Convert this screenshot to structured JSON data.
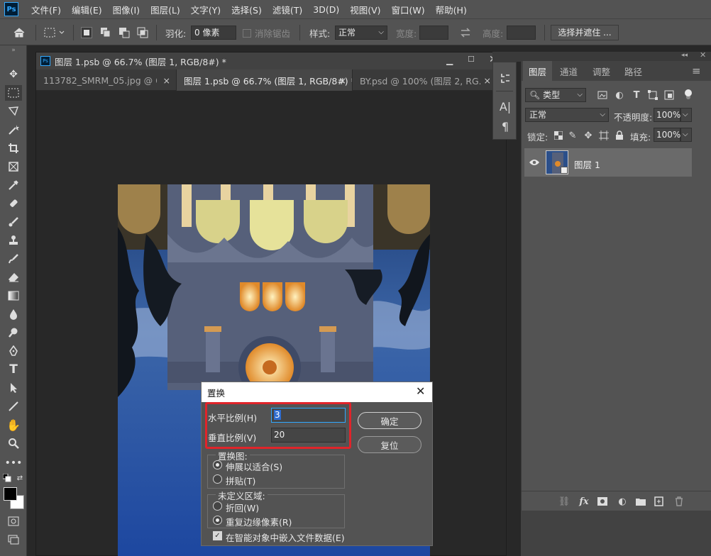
{
  "menu": {
    "logo": "Ps",
    "items": [
      "文件(F)",
      "编辑(E)",
      "图像(I)",
      "图层(L)",
      "文字(Y)",
      "选择(S)",
      "滤镜(T)",
      "3D(D)",
      "视图(V)",
      "窗口(W)",
      "帮助(H)"
    ]
  },
  "options": {
    "feather_label": "羽化:",
    "feather_value": "0 像素",
    "antialias_label": "消除锯齿",
    "style_label": "样式:",
    "style_value": "正常",
    "width_label": "宽度:",
    "height_label": "高度:",
    "select_mask_button": "选择并遮住 ..."
  },
  "document": {
    "title": "图层 1.psb @ 66.7% (图层 1, RGB/8#) *",
    "tabs": [
      {
        "label": "113782_SMRM_05.jpg @ 6...",
        "close": "×"
      },
      {
        "label": "图层 1.psb @ 66.7% (图层 1, RGB/8#) *",
        "close": "×"
      },
      {
        "label": "BY.psd @ 100% (图层 2, RG...",
        "close": "×"
      }
    ]
  },
  "dialog": {
    "title": "置换",
    "horizontal_label": "水平比例(H)",
    "horizontal_value": "3",
    "vertical_label": "垂直比例(V)",
    "vertical_value": "20",
    "ok_button": "确定",
    "reset_button": "复位",
    "map_group_label": "置换图:",
    "map_option_stretch": "伸展以适合(S)",
    "map_option_tile": "拼贴(T)",
    "undefined_group_label": "未定义区域:",
    "undefined_option_wrap": "折回(W)",
    "undefined_option_repeat": "重复边缘像素(R)",
    "embed_checkbox_label": "在智能对象中嵌入文件数据(E)",
    "highlight_color": "#e0242a"
  },
  "layers_panel": {
    "tabs": [
      "图层",
      "通道",
      "调整",
      "路径"
    ],
    "filter_value": "类型",
    "blend_mode": "正常",
    "opacity_label": "不透明度:",
    "opacity_value": "100%",
    "lock_label": "锁定:",
    "fill_label": "填充:",
    "fill_value": "100%",
    "layers": [
      {
        "name": "图层 1"
      }
    ]
  },
  "colors": {
    "accent": "#31a8ff"
  }
}
